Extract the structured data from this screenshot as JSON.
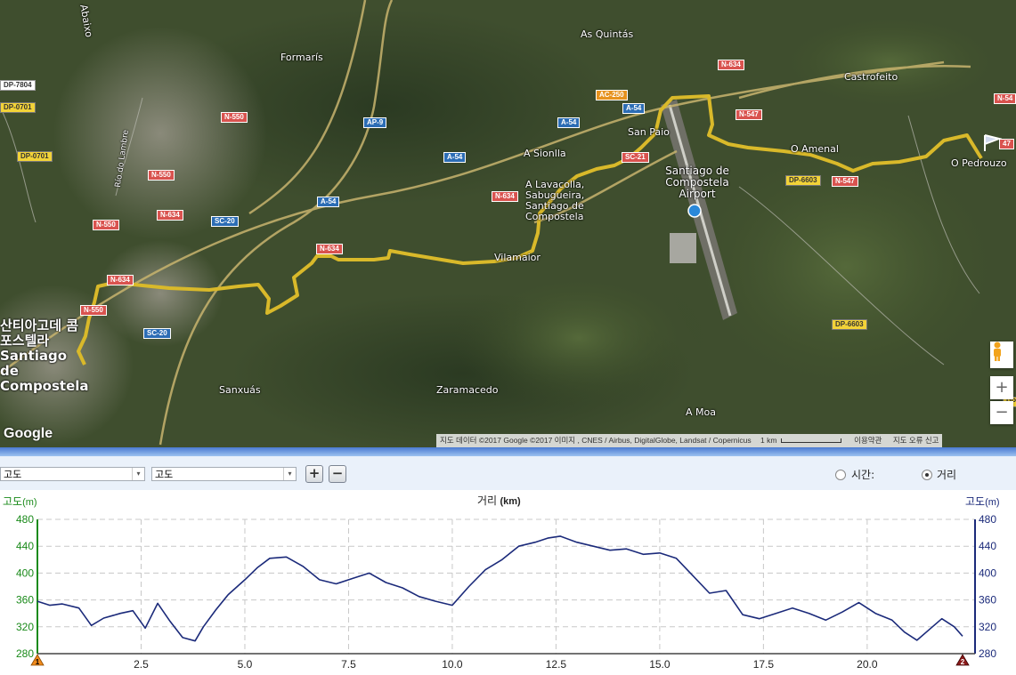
{
  "map": {
    "places": [
      {
        "id": "abaixo",
        "text": "Abaixo"
      },
      {
        "id": "formaris",
        "text": "Formarís"
      },
      {
        "id": "as-quintas",
        "text": "As Quintás"
      },
      {
        "id": "castrofeito",
        "text": "Castrofeito"
      },
      {
        "id": "san-paio",
        "text": "San Paio"
      },
      {
        "id": "a-sionlla",
        "text": "A Sionlla"
      },
      {
        "id": "o-amenal",
        "text": "O Amenal"
      },
      {
        "id": "o-pedrouzo",
        "text": "O Pedrouzo"
      },
      {
        "id": "lavacolla",
        "text": "A Lavacolla, Sabugueira, Santiago de Compostela"
      },
      {
        "id": "airport",
        "text": "Santiago de Compostela Airport"
      },
      {
        "id": "vilamaior",
        "text": "Vilamaior"
      },
      {
        "id": "sanxuas",
        "text": "Sanxuás"
      },
      {
        "id": "zaramacedo",
        "text": "Zaramacedo"
      },
      {
        "id": "a-moa",
        "text": "A Moa"
      },
      {
        "id": "rio-lambre",
        "text": "Río do Lambre"
      },
      {
        "id": "city",
        "text": "산티아고데 콤포스텔라 Santiago de Compostela"
      }
    ],
    "shields": [
      {
        "text": "DP-7804",
        "color": "white"
      },
      {
        "text": "DP-0701",
        "color": "yellow"
      },
      {
        "text": "DP-0701",
        "color": "yellow"
      },
      {
        "text": "N-550",
        "color": "red"
      },
      {
        "text": "N-550",
        "color": "red"
      },
      {
        "text": "N-550",
        "color": "red"
      },
      {
        "text": "N-550",
        "color": "red"
      },
      {
        "text": "N-634",
        "color": "red"
      },
      {
        "text": "N-634",
        "color": "red"
      },
      {
        "text": "N-634",
        "color": "red"
      },
      {
        "text": "N-634",
        "color": "red"
      },
      {
        "text": "N-634",
        "color": "red"
      },
      {
        "text": "SC-20",
        "color": "blue"
      },
      {
        "text": "SC-20",
        "color": "blue"
      },
      {
        "text": "A-54",
        "color": "blue"
      },
      {
        "text": "A-54",
        "color": "blue"
      },
      {
        "text": "A-54",
        "color": "blue"
      },
      {
        "text": "A-54",
        "color": "blue"
      },
      {
        "text": "AP-9",
        "color": "blue"
      },
      {
        "text": "AC-250",
        "color": "orange"
      },
      {
        "text": "SC-21",
        "color": "red"
      },
      {
        "text": "N-547",
        "color": "red"
      },
      {
        "text": "N-547",
        "color": "red"
      },
      {
        "text": "DP-6603",
        "color": "yellow"
      },
      {
        "text": "DP-6603",
        "color": "yellow"
      },
      {
        "text": "N-54",
        "color": "red"
      },
      {
        "text": "47",
        "color": "red"
      },
      {
        "text": "DP",
        "color": "yellow"
      }
    ],
    "attribution": "지도 데이터 ©2017 Google ©2017 이미지 , CNES / Airbus, DigitalGlobe, Landsat / Copernicus",
    "scale": "1 km",
    "terms": "이용약관",
    "report": "지도 오류 신고",
    "logo": "Google",
    "zoom_in": "+",
    "zoom_out": "−",
    "route_color": "#d9b92a"
  },
  "controls": {
    "select1": "고도",
    "select2": "고도",
    "plus": "+",
    "minus": "−",
    "radio_time": "시간:",
    "radio_distance": "거리",
    "radio_selected": "distance"
  },
  "chart_data": {
    "type": "line",
    "title": "거리 (km)",
    "title_main": "거리",
    "title_unit": "(km)",
    "ylabel_left": "고도(m)",
    "ylabel_right": "고도(m)",
    "ylabel_left_main": "고도",
    "ylabel_left_unit": "(m)",
    "ylabel_right_main": "고도",
    "ylabel_right_unit": "(m)",
    "xlim": [
      0,
      22.6
    ],
    "ylim": [
      280,
      480
    ],
    "yticks": [
      "480",
      "440",
      "400",
      "360",
      "320",
      "280"
    ],
    "xticks": [
      "2.5",
      "5.0",
      "7.5",
      "10.0",
      "12.5",
      "15.0",
      "17.5",
      "20.0"
    ],
    "start_marker": "1",
    "end_marker": "2",
    "line_color": "#1b2a7a",
    "x": [
      0,
      0.3,
      0.6,
      1.0,
      1.3,
      1.6,
      2.0,
      2.3,
      2.6,
      2.9,
      3.2,
      3.5,
      3.8,
      4.0,
      4.3,
      4.6,
      5.0,
      5.3,
      5.6,
      6.0,
      6.4,
      6.8,
      7.2,
      7.6,
      8.0,
      8.4,
      8.8,
      9.2,
      9.6,
      10.0,
      10.4,
      10.8,
      11.2,
      11.6,
      12.0,
      12.3,
      12.6,
      13.0,
      13.4,
      13.8,
      14.2,
      14.6,
      15.0,
      15.4,
      15.8,
      16.2,
      16.6,
      17.0,
      17.4,
      17.8,
      18.2,
      18.6,
      19.0,
      19.4,
      19.8,
      20.2,
      20.6,
      20.9,
      21.2,
      21.5,
      21.8,
      22.1,
      22.3
    ],
    "values": [
      358,
      352,
      354,
      348,
      322,
      333,
      340,
      344,
      318,
      355,
      328,
      304,
      299,
      320,
      345,
      368,
      390,
      408,
      422,
      424,
      410,
      390,
      384,
      392,
      400,
      386,
      378,
      365,
      358,
      352,
      380,
      405,
      420,
      440,
      446,
      452,
      455,
      446,
      440,
      434,
      436,
      428,
      430,
      422,
      396,
      370,
      374,
      338,
      332,
      340,
      348,
      340,
      330,
      342,
      356,
      340,
      330,
      312,
      300,
      316,
      332,
      320,
      306
    ]
  }
}
